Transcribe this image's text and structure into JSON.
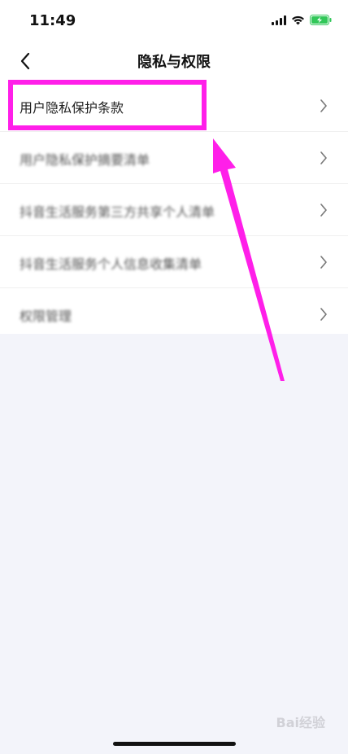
{
  "status_bar": {
    "time": "11:49",
    "icons": [
      "signal-icon",
      "wifi-icon",
      "battery-charging-icon"
    ],
    "battery_color": "#32c759"
  },
  "nav": {
    "title": "隐私与权限",
    "back_icon": "chevron-left-icon"
  },
  "menu": {
    "items": [
      {
        "label": "用户隐私保护条款"
      },
      {
        "label": "用户隐私保护摘要清单"
      },
      {
        "label": "抖音生活服务第三方共享个人清单"
      },
      {
        "label": "抖音生活服务个人信息收集清单"
      },
      {
        "label": "权限管理"
      }
    ]
  },
  "annotation": {
    "highlight_color": "#ff1fe9"
  },
  "watermark": {
    "text": "Bai经验"
  },
  "colors": {
    "page_bg": "#f3f4fa",
    "card_bg": "#ffffff",
    "text": "#222222"
  }
}
